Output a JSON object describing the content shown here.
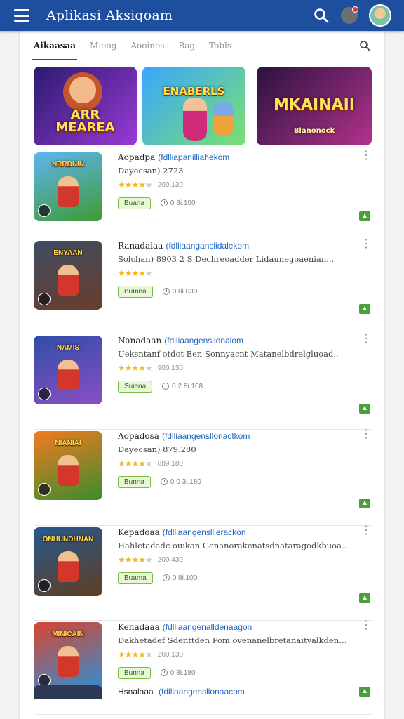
{
  "app_bar": {
    "title": "Aplikasi Aksiqoam",
    "icons": {
      "menu": "hamburger-icon",
      "search": "search-icon",
      "notifications": "notification-icon",
      "avatar": "user-avatar"
    }
  },
  "tabs": [
    {
      "label": "Aikaasaa",
      "active": true
    },
    {
      "label": "Mioog",
      "active": false
    },
    {
      "label": "Aooinos",
      "active": false
    },
    {
      "label": "Bag",
      "active": false
    },
    {
      "label": "Tobls",
      "active": false
    }
  ],
  "featured": [
    {
      "title": "ARR MEAREA",
      "colors": [
        "#2a1b6e",
        "#9a3ad6"
      ]
    },
    {
      "title": "ENABERLS",
      "colors": [
        "#39a6ff",
        "#7be070"
      ]
    },
    {
      "title": "MKAINAII",
      "subtitle": "Blanonock",
      "colors": [
        "#2a1240",
        "#b2328b"
      ]
    }
  ],
  "items": [
    {
      "name": "Aopadpa",
      "link": "(fdlliapanilliahekom",
      "desc": "Dayecsan) 2723",
      "rating_label": "200.130",
      "tag": "Buana",
      "meta": "0 8i.100",
      "thumb_title": "NRRDNIN",
      "thumb_colors": [
        "#5db6f0",
        "#3f9a34"
      ],
      "stars": 3.5
    },
    {
      "name": "Ranadaiaa",
      "link": "(fdlliaanganclidalekom",
      "desc": "Solchan) 8903 2 S Dechreoadder Lidaunegoaenian...",
      "rating_label": "",
      "tag": "Bumna",
      "meta": "0 8i 030",
      "thumb_title": "ENYAAN",
      "thumb_colors": [
        "#3d4e63",
        "#6b3c2a"
      ],
      "stars": 4
    },
    {
      "name": "Nanadaan",
      "link": "(fdlliaangensllonalom",
      "desc": "Ueksntanf otdot Ben Sonnyacnt Matanelbdrelgluoad..",
      "rating_label": "900.130",
      "tag": "Suiana",
      "meta": "0 2 8i.108",
      "thumb_title": "NAMIS",
      "thumb_colors": [
        "#2f4ea8",
        "#8a4fc4"
      ],
      "stars": 3.5
    },
    {
      "name": "Aopadosa",
      "link": "(fdlliaangensllonactkom",
      "desc": "Dayecsan) 879.280",
      "rating_label": "889.180",
      "tag": "Bunna",
      "meta": "0 0 3i.180",
      "thumb_title": "NIANIAI",
      "thumb_colors": [
        "#f27a22",
        "#3b8d2b"
      ],
      "stars": 3.5
    },
    {
      "name": "Kepadoaa",
      "link": "(fdlliaangenslllerackon",
      "desc": "Hahletadadc ouikan Genanorakenatsdnataragodkbuoa..",
      "rating_label": "200.430",
      "tag": "Buama",
      "meta": "0 8i.100",
      "thumb_title": "ONHUNDHNAN",
      "thumb_colors": [
        "#27588f",
        "#5e3e20"
      ],
      "stars": 4
    },
    {
      "name": "Kenadaaa",
      "link": "(fdlliaangenalldenaagon",
      "desc": "Dakhetadef Sdenttden Pom ovenanelbretanaitvalkdenao..",
      "rating_label": "200.130",
      "tag": "Bunna",
      "meta": "0 8i.180",
      "thumb_title": "MINICAIN",
      "thumb_colors": [
        "#d8452e",
        "#2f8fd4"
      ],
      "stars": 4
    }
  ],
  "partial_item": {
    "name": "Hsnalaaa",
    "link": "(fdlliaangensllonaacom"
  }
}
